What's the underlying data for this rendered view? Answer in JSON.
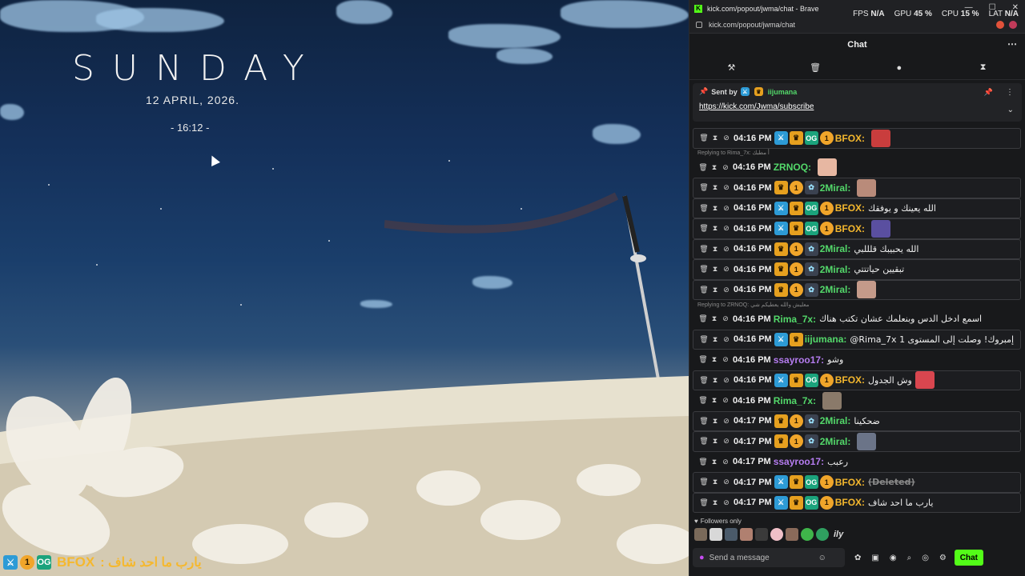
{
  "desktop": {
    "day": "SUNDAY",
    "date": "12 APRIL, 2026.",
    "time": "- 16:12 -"
  },
  "overlay": {
    "username": "BFOX",
    "message": ": يارب ما احد شاف"
  },
  "browser": {
    "window_title": "kick.com/popout/jwma/chat - Brave",
    "url": "kick.com/popout/jwma/chat",
    "perf": [
      {
        "label": "FPS",
        "value": "N/A"
      },
      {
        "label": "GPU",
        "value": "45 %"
      },
      {
        "label": "CPU",
        "value": "15 %"
      },
      {
        "label": "LAT",
        "value": "N/A"
      }
    ]
  },
  "chat": {
    "title": "Chat",
    "pinned": {
      "sent_by_label": "Sent by",
      "sender": "iijumana",
      "link": "https://kick.com/Jwma/subscribe"
    },
    "messages": [
      {
        "type": "msg",
        "time": "04:16 PM",
        "badges": [
          "mod",
          "vip",
          "og",
          "sub"
        ],
        "user": "BFOX",
        "color": "#f5b82e",
        "text": "",
        "emote": "#c93d3d",
        "hl": true
      },
      {
        "type": "reply",
        "text": "Replying to Rima_7x: أ مطبك"
      },
      {
        "type": "msg",
        "time": "04:16 PM",
        "badges": [],
        "user": "ZRNOQ",
        "color": "#53d86a",
        "text": "",
        "emote": "#e7b7a2",
        "hl": false
      },
      {
        "type": "msg",
        "time": "04:16 PM",
        "badges": [
          "vip",
          "sub",
          "gift"
        ],
        "user": "2Miral",
        "color": "#53d86a",
        "text": "",
        "emote": "#b98b7a",
        "hl": true
      },
      {
        "type": "msg",
        "time": "04:16 PM",
        "badges": [
          "mod",
          "vip",
          "og",
          "sub"
        ],
        "user": "BFOX",
        "color": "#f5b82e",
        "text": "الله يعينك و يوفقك",
        "emote": "",
        "hl": true
      },
      {
        "type": "msg",
        "time": "04:16 PM",
        "badges": [
          "mod",
          "vip",
          "og",
          "sub"
        ],
        "user": "BFOX",
        "color": "#f5b82e",
        "text": "",
        "emote": "#5a4fa0",
        "hl": true
      },
      {
        "type": "msg",
        "time": "04:16 PM",
        "badges": [
          "vip",
          "sub",
          "gift"
        ],
        "user": "2Miral",
        "color": "#53d86a",
        "text": "الله يحبيبك قلللبي",
        "emote": "",
        "hl": true
      },
      {
        "type": "msg",
        "time": "04:16 PM",
        "badges": [
          "vip",
          "sub",
          "gift"
        ],
        "user": "2Miral",
        "color": "#53d86a",
        "text": "تبقيين حياتتتي",
        "emote": "",
        "hl": true
      },
      {
        "type": "msg",
        "time": "04:16 PM",
        "badges": [
          "vip",
          "sub",
          "gift"
        ],
        "user": "2Miral",
        "color": "#53d86a",
        "text": "",
        "emote": "#c49a8a",
        "hl": true
      },
      {
        "type": "reply",
        "text": "Replying to ZRNOQ: معليش والله يعطيكم شي"
      },
      {
        "type": "msg",
        "time": "04:16 PM",
        "badges": [],
        "user": "Rima_7x",
        "color": "#53d86a",
        "text": "اسمع ادخل الدس وبنعلمك عشان تكتب هناك",
        "emote": "",
        "hl": false
      },
      {
        "type": "msg",
        "time": "04:16 PM",
        "badges": [
          "mod",
          "vip"
        ],
        "user": "iijumana",
        "color": "#53d86a",
        "text": "@Rima_7x إمبروك! وصلت إلى المستوى 1",
        "emote": "",
        "hl": true
      },
      {
        "type": "msg",
        "time": "04:16 PM",
        "badges": [],
        "user": "ssayroo17",
        "color": "#b57cf0",
        "text": "وشو",
        "emote": "",
        "hl": false
      },
      {
        "type": "msg",
        "time": "04:16 PM",
        "badges": [
          "mod",
          "vip",
          "og",
          "sub"
        ],
        "user": "BFOX",
        "color": "#f5b82e",
        "text": "وش الجدول",
        "emote": "#d9464f",
        "hl": true
      },
      {
        "type": "msg",
        "time": "04:16 PM",
        "badges": [],
        "user": "Rima_7x",
        "color": "#53d86a",
        "text": "",
        "emote": "#8a7a6a",
        "hl": false
      },
      {
        "type": "msg",
        "time": "04:17 PM",
        "badges": [
          "vip",
          "sub",
          "gift"
        ],
        "user": "2Miral",
        "color": "#53d86a",
        "text": "ضحكينا",
        "emote": "",
        "hl": true
      },
      {
        "type": "msg",
        "time": "04:17 PM",
        "badges": [
          "vip",
          "sub",
          "gift"
        ],
        "user": "2Miral",
        "color": "#53d86a",
        "text": "",
        "emote": "#6b7488",
        "hl": true
      },
      {
        "type": "msg",
        "time": "04:17 PM",
        "badges": [],
        "user": "ssayroo17",
        "color": "#b57cf0",
        "text": "رعبب",
        "emote": "",
        "hl": false
      },
      {
        "type": "msg",
        "time": "04:17 PM",
        "badges": [
          "mod",
          "vip",
          "og",
          "sub"
        ],
        "user": "BFOX",
        "color": "#f5b82e",
        "text": "(Deleted)",
        "emote": "",
        "hl": true,
        "deleted": true
      },
      {
        "type": "msg",
        "time": "04:17 PM",
        "badges": [
          "mod",
          "vip",
          "og",
          "sub"
        ],
        "user": "BFOX",
        "color": "#f5b82e",
        "text": "يارب ما احد شاف",
        "emote": "",
        "hl": true
      }
    ],
    "followers_label": "Followers only",
    "emote_bar_text": "ily",
    "input_placeholder": "Send a message",
    "send_button": "Chat"
  }
}
